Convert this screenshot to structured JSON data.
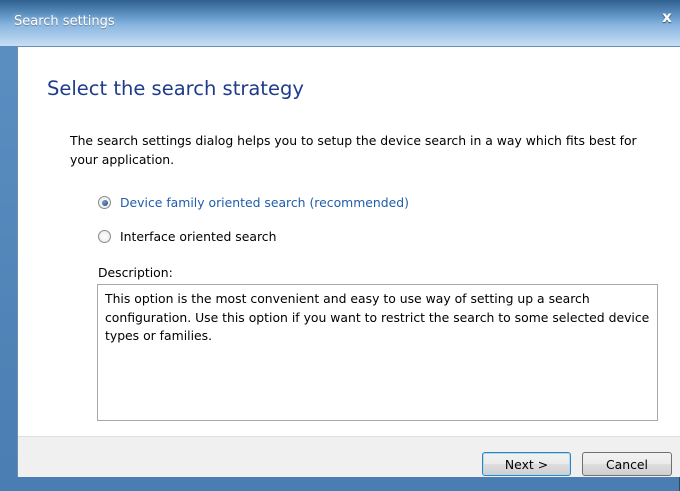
{
  "window": {
    "title": "Search settings",
    "close_label": "x"
  },
  "page": {
    "heading": "Select the search strategy",
    "intro": "The search settings dialog helps you to setup the device search in a way which fits best for your application."
  },
  "options": [
    {
      "label": "Device family oriented search (recommended)",
      "checked": true
    },
    {
      "label": "Interface oriented search",
      "checked": false
    }
  ],
  "description": {
    "label": "Description:",
    "text": "This option is the most convenient and easy to use way of setting up a search configuration. Use this option if you want to restrict the search to some selected device types or families."
  },
  "buttons": {
    "next": "Next >",
    "cancel": "Cancel"
  },
  "colors": {
    "heading": "#1e3b8c",
    "selected_option": "#1f5dab",
    "title_bar": "#4a7eb2"
  }
}
